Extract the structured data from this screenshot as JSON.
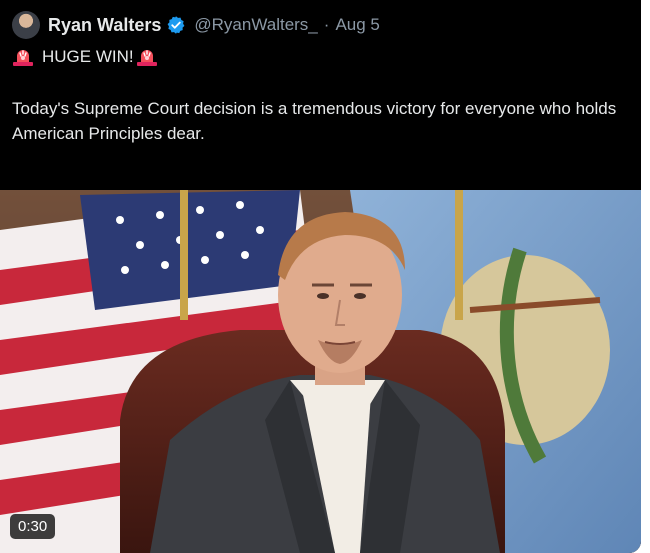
{
  "tweet": {
    "author_name": "Ryan Walters",
    "handle": "@RyanWalters_",
    "separator": "·",
    "date": "Aug 5",
    "headline": "HUGE WIN!",
    "body": "Today's Supreme Court decision is a tremendous victory for everyone who holds American Principles dear.",
    "icons": [
      "avatar",
      "verified-badge-icon",
      "siren-emoji-icon"
    ],
    "verified_color": "#1d9bf0"
  },
  "video": {
    "duration": "0:30"
  }
}
